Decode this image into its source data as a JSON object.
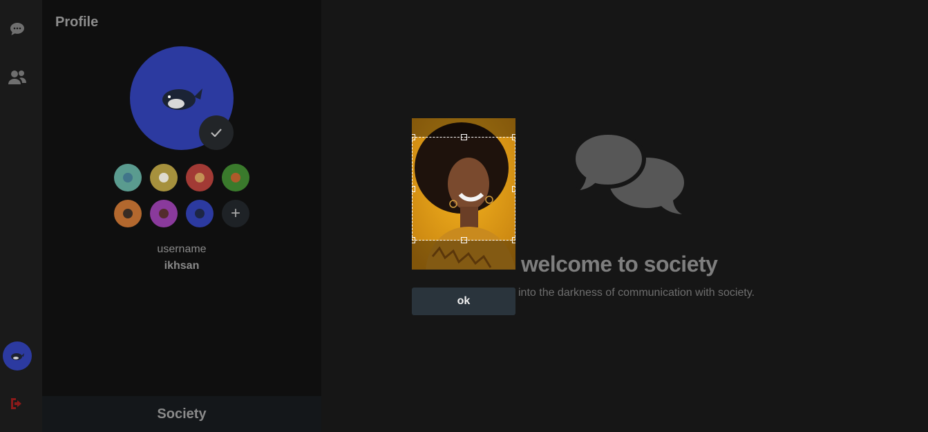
{
  "rail": {
    "icons": [
      "chat-icon",
      "users-icon",
      "logout-icon"
    ],
    "logout_color": "#8b1a1a"
  },
  "profile": {
    "title": "Profile",
    "avatar_color": "#2c3aa0",
    "avatar_icon": "whale-icon",
    "options": [
      {
        "color": "#5a9b8f",
        "icon": "elephant-icon"
      },
      {
        "color": "#a6913d",
        "icon": "panda-icon"
      },
      {
        "color": "#a23a35",
        "icon": "monkey-icon"
      },
      {
        "color": "#3a7a2c",
        "icon": "bird-icon"
      },
      {
        "color": "#b3682e",
        "icon": "penguin-icon"
      },
      {
        "color": "#8a3a9c",
        "icon": "bear-icon"
      },
      {
        "color": "#2c3aa0",
        "icon": "whale-icon"
      }
    ],
    "username_label": "username",
    "username_value": "ikhsan",
    "brand": "Society"
  },
  "welcome": {
    "title": "welcome to society",
    "subtitle": "into the darkness of communication with society."
  },
  "cropper": {
    "ok_label": "ok"
  },
  "colors": {
    "background": "#161616",
    "panel": "#0f0f0f",
    "accent": "#2c3aa0"
  }
}
